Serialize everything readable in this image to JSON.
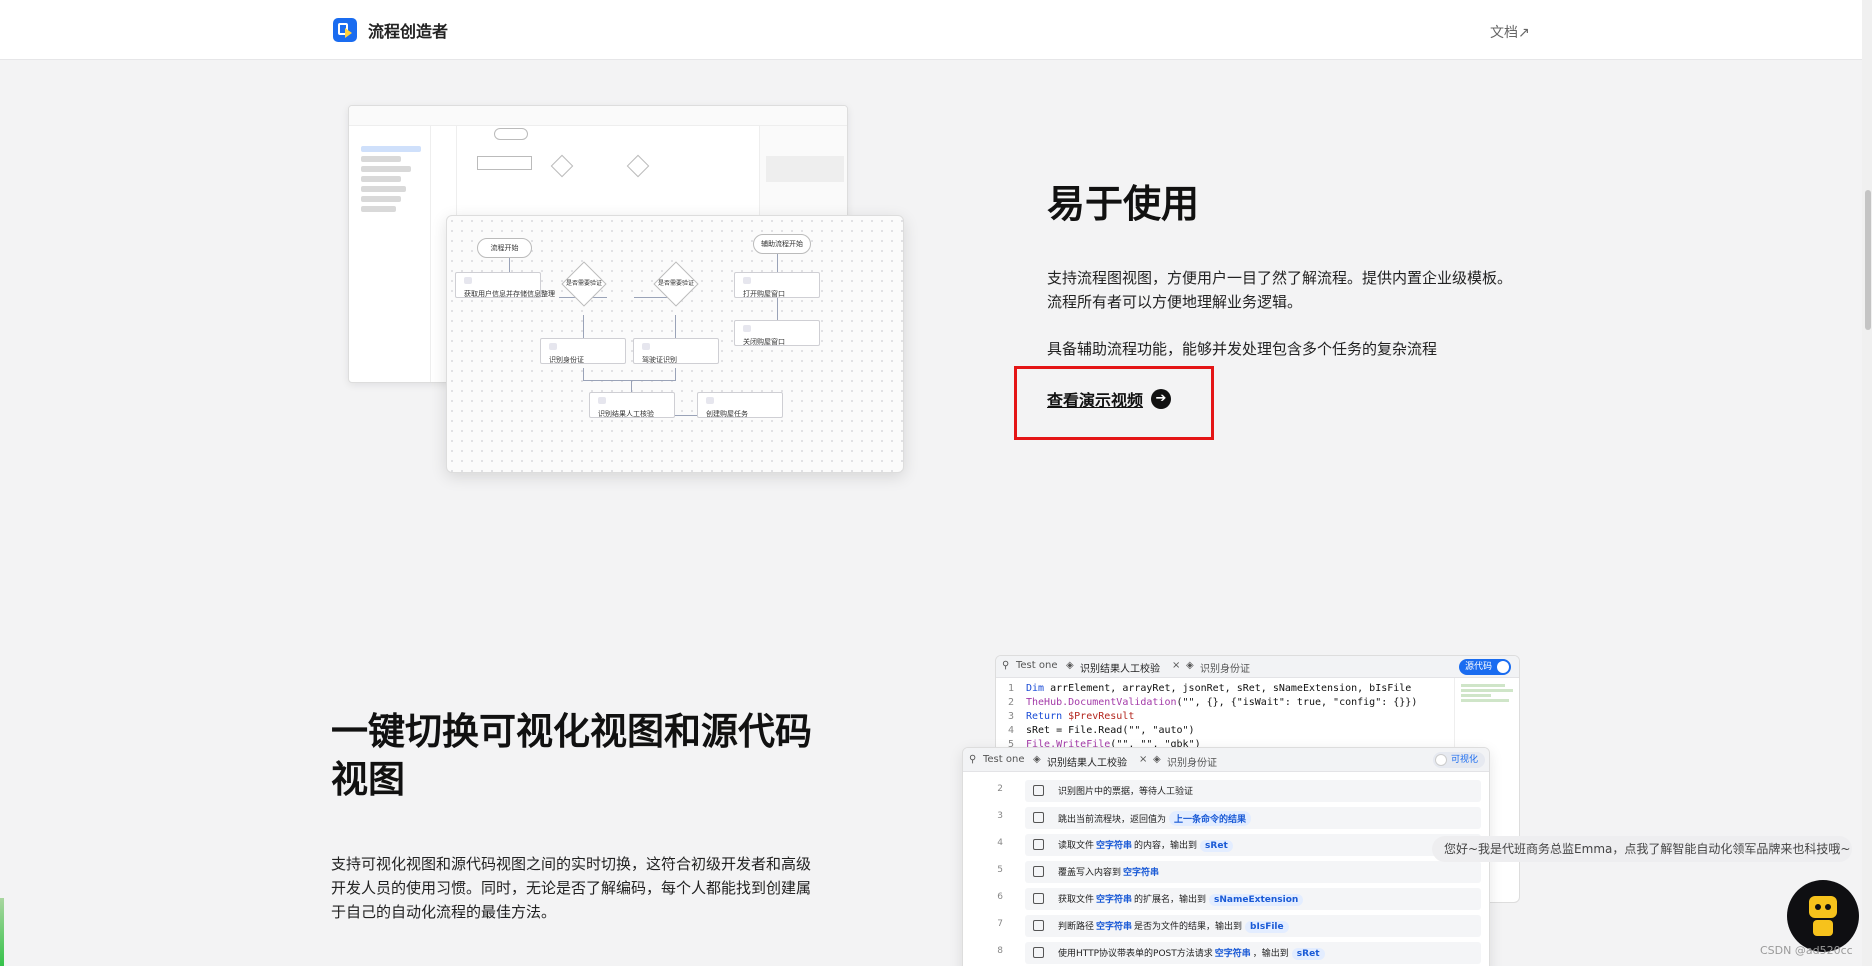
{
  "header": {
    "brand": "流程创造者",
    "docs_link": "文档↗"
  },
  "section_easy": {
    "title": "易于使用",
    "desc1": "支持流程图视图，方便用户一目了然了解流程。提供内置企业级模板。流程所有者可以方便地理解业务逻辑。",
    "desc2": "具备辅助流程功能，能够并发处理包含多个任务的复杂流程",
    "video_link": "查看演示视频"
  },
  "flow_front": {
    "start": "流程开始",
    "aux_start": "辅助流程开始",
    "node1_text": "获取用户信息并存储信息整理",
    "diamond1": "是否需要验证",
    "diamond2": "是否需要验证",
    "node_right1": "打开购屋窗口",
    "node_right2": "关闭购屋窗口",
    "node2_text": "识别身份证",
    "node3_text": "驾驶证识别",
    "node4_text": "识别结果人工核验",
    "node5_text": "创建购屋任务"
  },
  "section_switch": {
    "title": "一键切换可视化视图和源代码视图",
    "desc": "支持可视化视图和源代码视图之间的实时切换，这符合初级开发者和高级开发人员的使用习惯。同时，无论是否了解编码，每个人都能找到创建属于自己的自动化流程的最佳方法。"
  },
  "code_panel": {
    "tab1": "Test one",
    "tab2": "识别结果人工校验",
    "tab3": "识别身份证",
    "toggle": "源代码",
    "lines": [
      {
        "n": "1",
        "kw": "Dim",
        "rest": " arrElement, arrayRet, jsonRet, sRet, sNameExtension, bIsFile"
      },
      {
        "n": "2",
        "fn": "TheHub.DocumentValidation",
        "rest": "(\"\", {}, {\"isWait\": true, \"config\": {}})"
      },
      {
        "n": "3",
        "kw": "Return",
        "rest": " $PrevResult"
      },
      {
        "n": "4",
        "kw": "",
        "rest": "sRet = File.Read(\"\", \"auto\")"
      },
      {
        "n": "5",
        "fn": "File.WriteFile",
        "rest": "(\"\", \"\", \"gbk\")"
      }
    ]
  },
  "vis_panel": {
    "tab1": "Test one",
    "tab2": "识别结果人工校验",
    "tab3": "识别身份证",
    "toggle": "可视化",
    "rows": [
      {
        "n": "2",
        "a": "识别图片中的票据，等待人工验证",
        "t1": "",
        "b": "",
        "t2": ""
      },
      {
        "n": "3",
        "a": "跳出当前流程块，返回值为",
        "t1": "上一条命令的结果",
        "b": "",
        "t2": ""
      },
      {
        "n": "4",
        "a": "读取文件",
        "t1": "空字符串",
        "b": "的内容，输出到",
        "t2": "sRet"
      },
      {
        "n": "5",
        "a": "覆盖写入内容到",
        "t1": "空字符串",
        "b": "",
        "t2": ""
      },
      {
        "n": "6",
        "a": "获取文件",
        "t1": "空字符串",
        "b": "的扩展名，输出到",
        "t2": "sNameExtension"
      },
      {
        "n": "7",
        "a": "判断路径",
        "t1": "空字符串",
        "b": "是否为文件的结果，输出到",
        "t2": "bIsFile"
      },
      {
        "n": "8",
        "a": "使用HTTP协议带表单的POST方法请求",
        "t1": "空字符串",
        "b": "，输出到",
        "t2": "sRet"
      }
    ]
  },
  "chat": {
    "bubble": "您好~我是代班商务总监Emma，点我了解智能自动化领军品牌来也科技哦~",
    "watermark": "CSDN @ad520cc"
  },
  "colors": {
    "accent": "#1a6cf0",
    "highlight_box": "#e41515"
  },
  "icons": [
    "logo-icon",
    "arrow-right-circle-icon",
    "tree-icon",
    "layers-icon",
    "close-icon",
    "robot-avatar-icon"
  ]
}
